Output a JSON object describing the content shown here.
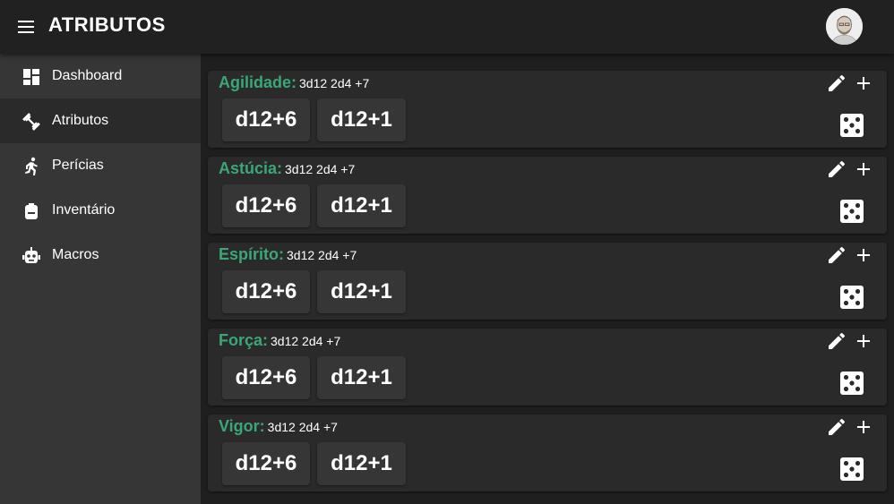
{
  "app": {
    "title": "ATRIBUTOS"
  },
  "icons": {
    "menu": "menu-icon",
    "avatar": "user-avatar",
    "edit": "pencil-icon",
    "add": "plus-icon",
    "dice": "dice-five-icon"
  },
  "colors": {
    "accent": "#3ba777",
    "appbar": "#212121",
    "sidebar": "#363636",
    "sidebar_active": "#2a2a2a",
    "card": "#2a2a2a",
    "chip": "#363636"
  },
  "sidebar": {
    "items": [
      {
        "label": "Dashboard",
        "icon": "dashboard-icon",
        "active": false
      },
      {
        "label": "Atributos",
        "icon": "dumbbell-icon",
        "active": true
      },
      {
        "label": "Perícias",
        "icon": "running-icon",
        "active": false
      },
      {
        "label": "Inventário",
        "icon": "backpack-icon",
        "active": false
      },
      {
        "label": "Macros",
        "icon": "robot-icon",
        "active": false
      }
    ]
  },
  "attributes": [
    {
      "name": "Agilidade:",
      "formula": "3d12 2d4 +7",
      "rolls": [
        "d12+6",
        "d12+1"
      ]
    },
    {
      "name": "Astúcia:",
      "formula": "3d12 2d4 +7",
      "rolls": [
        "d12+6",
        "d12+1"
      ]
    },
    {
      "name": "Espírito:",
      "formula": "3d12 2d4 +7",
      "rolls": [
        "d12+6",
        "d12+1"
      ]
    },
    {
      "name": "Força:",
      "formula": "3d12 2d4 +7",
      "rolls": [
        "d12+6",
        "d12+1"
      ]
    },
    {
      "name": "Vigor:",
      "formula": "3d12 2d4 +7",
      "rolls": [
        "d12+6",
        "d12+1"
      ]
    }
  ]
}
